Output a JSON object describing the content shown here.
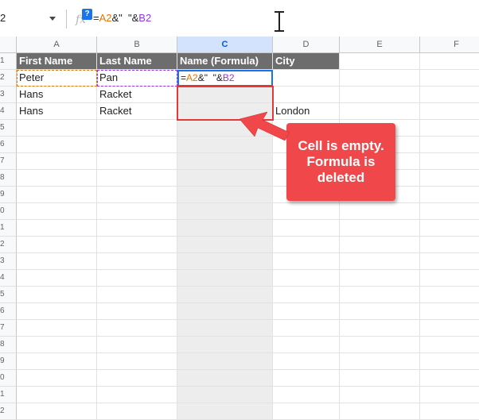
{
  "formula_bar": {
    "name_box": "2",
    "help_badge": "?",
    "fx": "fx",
    "formula_parts": [
      "=",
      "A2",
      "&\"  \"&",
      "B2"
    ]
  },
  "grid": {
    "columns": [
      "A",
      "B",
      "C",
      "D",
      "E",
      "F"
    ],
    "selected_column": "C",
    "row_numbers": [
      "1",
      "2",
      "3",
      "4",
      "5",
      "6",
      "7",
      "8",
      "9",
      "0",
      "1",
      "2",
      "3",
      "4",
      "5",
      "6",
      "7",
      "8",
      "9",
      "0",
      "1",
      "2"
    ],
    "header_row": [
      "First Name",
      "Last Name",
      "Name (Formula)",
      "City"
    ],
    "rows": [
      [
        "Peter",
        "Pan",
        "",
        ""
      ],
      [
        "Hans",
        "Racket",
        "",
        ""
      ],
      [
        "Hans",
        "Racket",
        "",
        "London"
      ]
    ],
    "active_cell_formula": [
      "=",
      "A2",
      "&\"  \"&",
      "B2"
    ]
  },
  "callout": {
    "text": "Cell is empty.\nFormula is\ndeleted",
    "color": "#f0474a"
  },
  "colors": {
    "header_fill": "#6d6d6d",
    "ref_a": "#e37400",
    "ref_b": "#9334e6",
    "selection_blue": "#1a73e8",
    "highlight_red": "#e53935"
  }
}
